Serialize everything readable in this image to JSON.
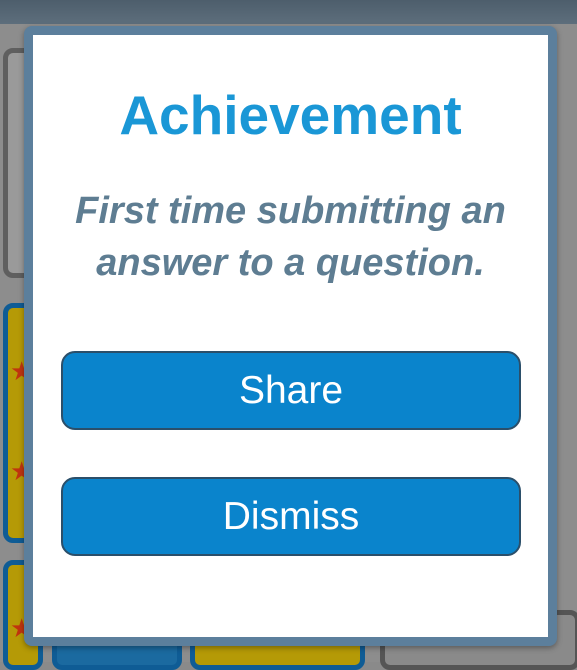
{
  "dialog": {
    "title": "Achievement",
    "message": "First time submitting an answer to a question.",
    "share_label": "Share",
    "dismiss_label": "Dismiss"
  },
  "colors": {
    "title": "#1a97d6",
    "message": "#5e7d92",
    "button": "#0a84cc",
    "modal_border": "#5c7f9c"
  },
  "icons": {
    "background_badge_icon": "star-icon"
  }
}
